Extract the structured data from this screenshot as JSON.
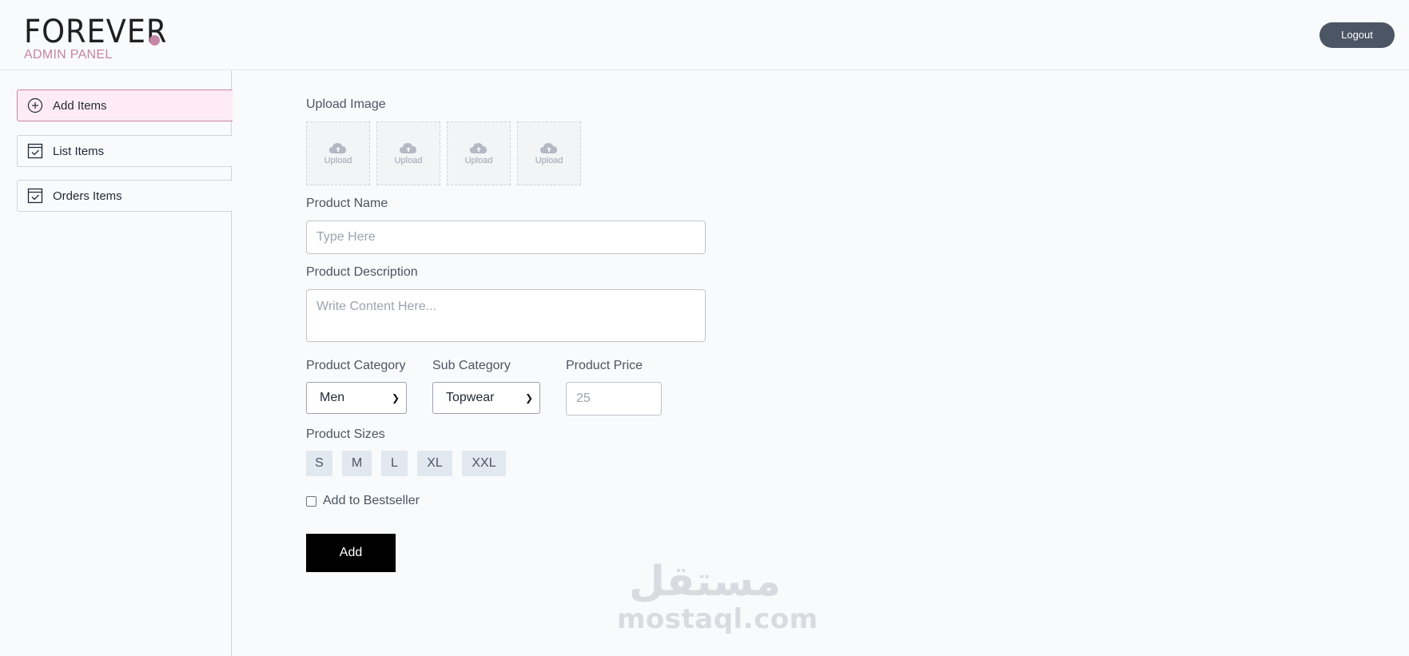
{
  "header": {
    "logo_word": "FOREVER",
    "logo_sub": "ADMIN PANEL",
    "logout_label": "Logout"
  },
  "sidebar": {
    "items": [
      {
        "label": "Add Items",
        "icon": "plus-circle-icon",
        "active": true
      },
      {
        "label": "List Items",
        "icon": "calendar-check-icon",
        "active": false
      },
      {
        "label": "Orders Items",
        "icon": "calendar-check-icon",
        "active": false
      }
    ]
  },
  "form": {
    "upload_image_label": "Upload Image",
    "upload_boxes": [
      "Upload",
      "Upload",
      "Upload",
      "Upload"
    ],
    "product_name_label": "Product Name",
    "product_name_placeholder": "Type Here",
    "product_description_label": "Product Description",
    "product_description_placeholder": "Write Content Here...",
    "product_category_label": "Product Category",
    "product_category_value": "Men",
    "sub_category_label": "Sub Category",
    "sub_category_value": "Topwear",
    "product_price_label": "Product Price",
    "product_price_placeholder": "25",
    "product_sizes_label": "Product Sizes",
    "sizes": [
      "S",
      "M",
      "L",
      "XL",
      "XXL"
    ],
    "bestseller_label": "Add to Bestseller",
    "bestseller_checked": false,
    "submit_label": "Add"
  },
  "watermark": {
    "arabic": "مستقل",
    "latin": "mostaql.com"
  },
  "colors": {
    "accent": "#c586a5",
    "active_bg": "#ffebf5",
    "logout_bg": "#4b5563",
    "size_bg": "#e2e8f0",
    "submit_bg": "#000000"
  }
}
